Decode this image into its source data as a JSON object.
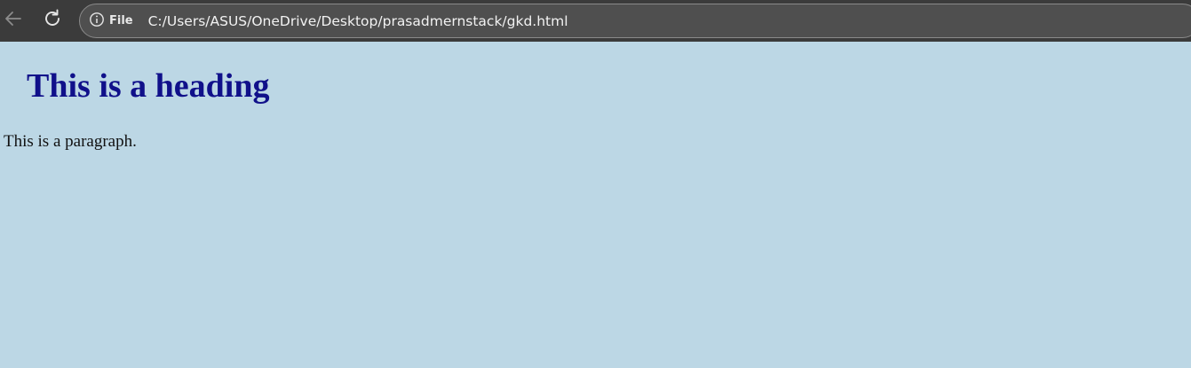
{
  "browser": {
    "site_info_label": "File",
    "url": "C:/Users/ASUS/OneDrive/Desktop/prasadmernstack/gkd.html",
    "icons": {
      "back": "back-arrow-icon",
      "reload": "reload-icon",
      "info": "info-icon"
    }
  },
  "page": {
    "heading": "This is a heading",
    "paragraph": "This is a paragraph.",
    "background_color": "#bcd7e5",
    "heading_color": "#10108a"
  }
}
